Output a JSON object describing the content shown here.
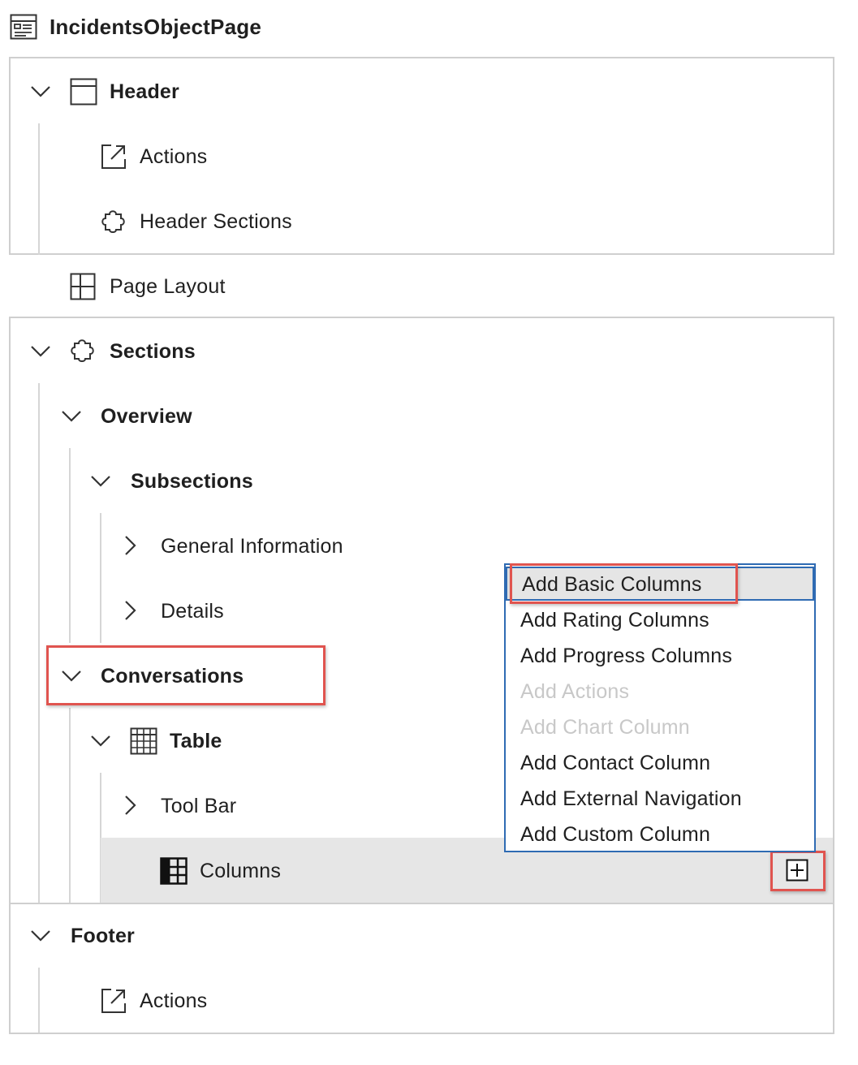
{
  "page": {
    "title": "IncidentsObjectPage",
    "title_icon": "object-page-icon"
  },
  "tree": {
    "header": {
      "label": "Header",
      "icon": "header-icon",
      "children": [
        {
          "label": "Actions",
          "icon": "external-link-icon"
        },
        {
          "label": "Header Sections",
          "icon": "puzzle-icon"
        }
      ]
    },
    "page_layout": {
      "label": "Page Layout",
      "icon": "layout-icon"
    },
    "sections": {
      "label": "Sections",
      "icon": "puzzle-icon",
      "overview": {
        "label": "Overview",
        "subsections": {
          "label": "Subsections",
          "items": [
            {
              "label": "General Information"
            },
            {
              "label": "Details"
            }
          ]
        }
      },
      "conversations": {
        "label": "Conversations",
        "table": {
          "label": "Table",
          "icon": "table-icon",
          "toolbar": {
            "label": "Tool Bar"
          },
          "columns": {
            "label": "Columns",
            "icon": "columns-icon",
            "add_button_icon": "add-icon"
          }
        }
      }
    },
    "footer": {
      "label": "Footer",
      "children": [
        {
          "label": "Actions",
          "icon": "external-link-icon"
        }
      ]
    }
  },
  "context_menu": {
    "items": [
      {
        "label": "Add Basic Columns",
        "enabled": true,
        "selected": true
      },
      {
        "label": "Add Rating Columns",
        "enabled": true
      },
      {
        "label": "Add Progress Columns",
        "enabled": true
      },
      {
        "label": "Add Actions",
        "enabled": false
      },
      {
        "label": "Add Chart Column",
        "enabled": false
      },
      {
        "label": "Add Contact Column",
        "enabled": true
      },
      {
        "label": "Add External Navigation",
        "enabled": true
      },
      {
        "label": "Add Custom Column",
        "enabled": true
      }
    ]
  },
  "colors": {
    "highlight": "#e0544f",
    "menu_border": "#2f6bb3",
    "selected_row": "#e5e5e5",
    "disabled_text": "#c8c8c8"
  }
}
